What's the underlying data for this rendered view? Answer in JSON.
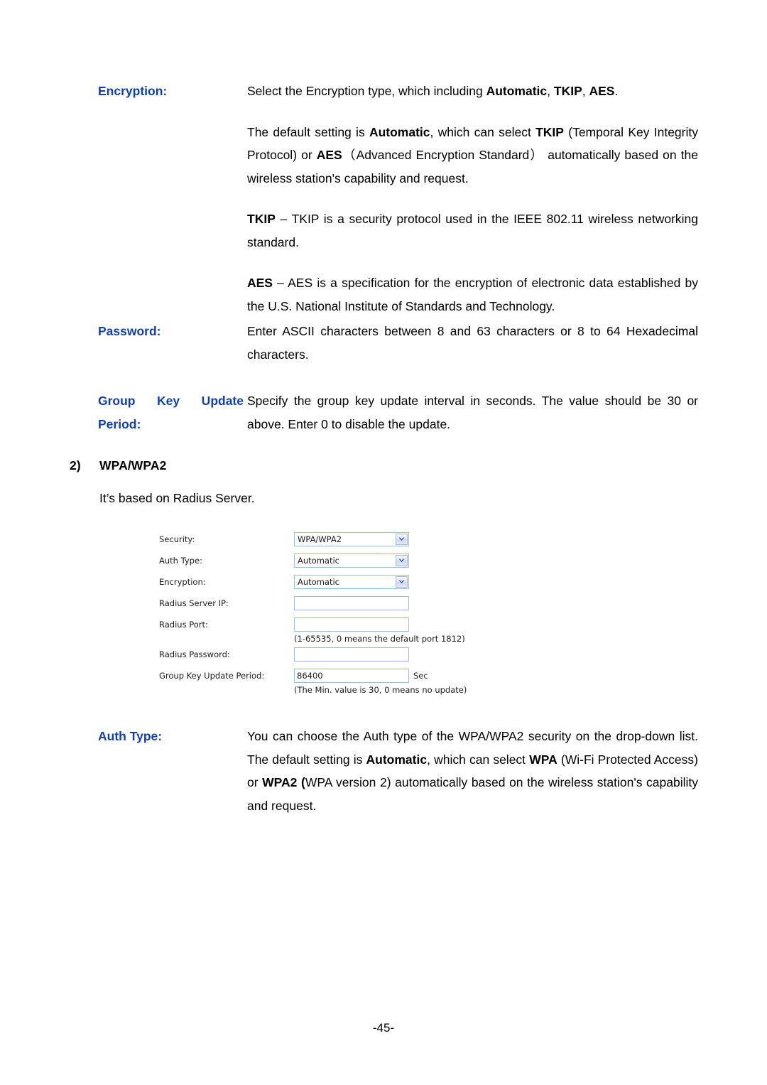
{
  "sections": {
    "encryption": {
      "label": "Encryption:",
      "paragraphs": [
        [
          {
            "t": "Select the Encryption type, which including ",
            "b": false
          },
          {
            "t": "Automatic",
            "b": true
          },
          {
            "t": ", ",
            "b": false
          },
          {
            "t": "TKIP",
            "b": true
          },
          {
            "t": ", ",
            "b": false
          },
          {
            "t": "AES",
            "b": true
          },
          {
            "t": ".",
            "b": false
          }
        ],
        [
          {
            "t": "The default setting is ",
            "b": false
          },
          {
            "t": "Automatic",
            "b": true
          },
          {
            "t": ", which can select ",
            "b": false
          },
          {
            "t": "TKIP",
            "b": true
          },
          {
            "t": " (Temporal Key Integrity Protocol) or ",
            "b": false
          },
          {
            "t": "AES",
            "b": true
          },
          {
            "t": "（Advanced Encryption Standard） automatically based on the wireless station's capability and request.",
            "b": false
          }
        ],
        [
          {
            "t": "TKIP",
            "b": true
          },
          {
            "t": " – TKIP is a security protocol used in the IEEE 802.11 wireless networking standard.",
            "b": false
          }
        ],
        [
          {
            "t": "AES",
            "b": true
          },
          {
            "t": " – AES is a specification for the encryption of electronic data established by the U.S. National Institute of Standards and Technology.",
            "b": false
          }
        ]
      ]
    },
    "password": {
      "label": "Password:",
      "paragraphs": [
        [
          {
            "t": "Enter ASCII characters between 8 and 63 characters or 8 to 64 Hexadecimal characters.",
            "b": false
          }
        ]
      ]
    },
    "group_key_update_period": {
      "label_lines": [
        "Group Key Update",
        "Period:"
      ],
      "paragraphs": [
        [
          {
            "t": "Specify the group key update interval in seconds. The value should be 30 or above. Enter 0 to disable the update.",
            "b": false
          }
        ]
      ]
    },
    "auth_type": {
      "label": "Auth Type:",
      "paragraphs": [
        [
          {
            "t": "You can choose the Auth type of the WPA/WPA2 security on the drop-down list. The default setting is ",
            "b": false
          },
          {
            "t": "Automatic",
            "b": true
          },
          {
            "t": ", which can select ",
            "b": false
          },
          {
            "t": "WPA",
            "b": true
          },
          {
            "t": " (Wi-Fi Protected Access) or ",
            "b": false
          },
          {
            "t": "WPA2 (",
            "b": true
          },
          {
            "t": "WPA version 2) automatically based on the wireless station's capability and request.",
            "b": false
          }
        ]
      ]
    }
  },
  "heading": {
    "index": "2)",
    "title": "WPA/WPA2"
  },
  "intro_text": "It’s based on Radius Server.",
  "screenshot": {
    "rows": [
      {
        "label": "Security:",
        "type": "select",
        "value": "WPA/WPA2"
      },
      {
        "label": "Auth Type:",
        "type": "select",
        "value": "Automatic"
      },
      {
        "label": "Encryption:",
        "type": "select",
        "value": "Automatic"
      },
      {
        "label": "Radius Server IP:",
        "type": "text",
        "value": ""
      },
      {
        "label": "Radius Port:",
        "type": "text",
        "value": ""
      },
      {
        "label": "Radius Password:",
        "type": "text",
        "value": ""
      },
      {
        "label": "Group Key Update Period:",
        "type": "text",
        "value": "86400",
        "unit": "Sec"
      }
    ],
    "hints": {
      "radius_port": "(1-65535, 0 means the default port 1812)",
      "group_key": "(The Min. value is 30, 0 means no update)"
    }
  },
  "footer": {
    "page_number": "-45-"
  },
  "colors": {
    "heading_blue": "#1140A8",
    "field_border": "#9dbdd2",
    "body_text": "#000000"
  }
}
